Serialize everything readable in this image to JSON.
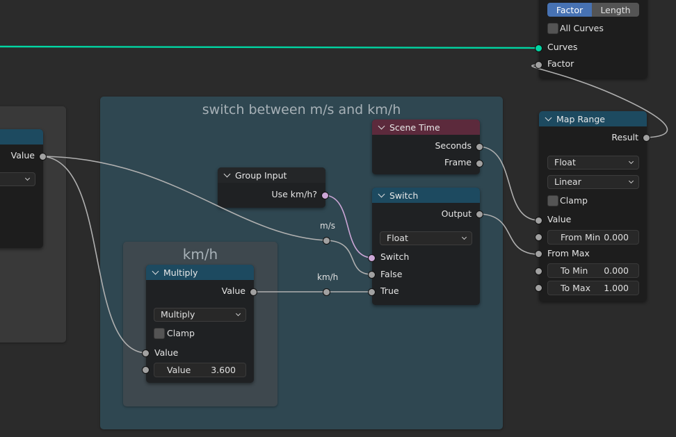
{
  "frames": {
    "main_title": "switch between m/s and km/h",
    "kmh_title": "km/h"
  },
  "colors": {
    "background": "#2b2b2b",
    "frame_main": "#2f4751",
    "frame_kmh": "#3e484e",
    "header_blue": "#1d4a60",
    "header_red": "#5c2a3c",
    "socket_float": "#a1a1a1",
    "socket_bool": "#cca6d6",
    "socket_geometry": "#00d6a3",
    "wire": "#b0b0b0",
    "toggle_active": "#4772b3"
  },
  "curve_node": {
    "mode_options": [
      "Factor",
      "Length"
    ],
    "mode_selected": "Factor",
    "all_curves_label": "All Curves",
    "all_curves_checked": false,
    "inputs": [
      "Curves",
      "Factor"
    ]
  },
  "map_range": {
    "title": "Map Range",
    "output": "Result",
    "data_type": "Float",
    "interpolation": "Linear",
    "clamp_label": "Clamp",
    "clamp_checked": false,
    "value_label": "Value",
    "from_min_label": "From Min",
    "from_min_value": "0.000",
    "from_max_label": "From Max",
    "to_min_label": "To Min",
    "to_min_value": "0.000",
    "to_max_label": "To Max",
    "to_max_value": "1.000"
  },
  "scene_time": {
    "title": "Scene Time",
    "outputs": [
      "Seconds",
      "Frame"
    ]
  },
  "switch_node": {
    "title": "Switch",
    "output": "Output",
    "data_type": "Float",
    "inputs": [
      "Switch",
      "False",
      "True"
    ]
  },
  "group_input": {
    "title": "Group Input",
    "output": "Use km/h?"
  },
  "reroutes": {
    "ms_label": "m/s",
    "kmh_label": "km/h"
  },
  "multiply_node": {
    "title": "Multiply",
    "output": "Value",
    "operation": "Multiply",
    "clamp_label": "Clamp",
    "clamp_checked": false,
    "input_label": "Value",
    "field_label": "Value",
    "field_value": "3.600"
  },
  "left_node": {
    "output": "Value"
  }
}
